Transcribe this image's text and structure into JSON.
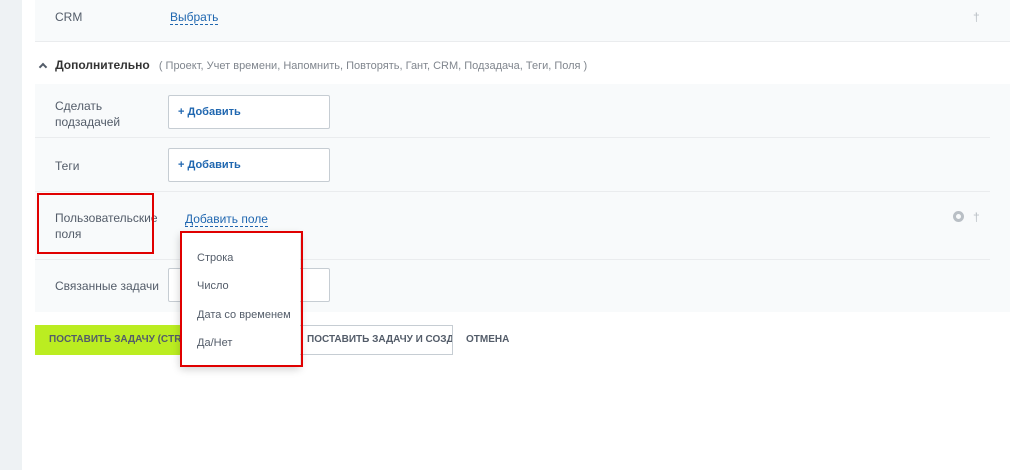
{
  "crm_row": {
    "label": "CRM",
    "select_link": "Выбрать",
    "pin_glyph": "†"
  },
  "extra_section": {
    "title": "Дополнительно",
    "items_text": "( Проект,  Учет времени,  Напомнить,  Повторять,  Гант,  CRM,  Подзадача,  Теги,  Поля )"
  },
  "subtask_row": {
    "label_line1": "Сделать",
    "label_line2": "подзадачей",
    "add_label": "+ Добавить"
  },
  "tags_row": {
    "label": "Теги",
    "add_label": "+ Добавить"
  },
  "custom_fields_row": {
    "label_line1": "Пользовательские",
    "label_line2": "поля",
    "add_field_link": "Добавить поле",
    "pin_glyph": "†"
  },
  "related_row": {
    "label": "Связанные задачи"
  },
  "field_type_menu": {
    "items": [
      "Строка",
      "Число",
      "Дата со временем",
      "Да/Нет"
    ]
  },
  "footer": {
    "submit_label": "ПОСТАВИТЬ ЗАДАЧУ (CTRL+ENTER)",
    "submit_more_label": "ПОСТАВИТЬ ЗАДАЧУ И СОЗДАТЬ ЕЩЕ",
    "cancel_label": "ОТМЕНА"
  },
  "colors": {
    "accent_green": "#bbed21",
    "link_blue": "#2067b0",
    "highlight_red": "#e00000"
  }
}
